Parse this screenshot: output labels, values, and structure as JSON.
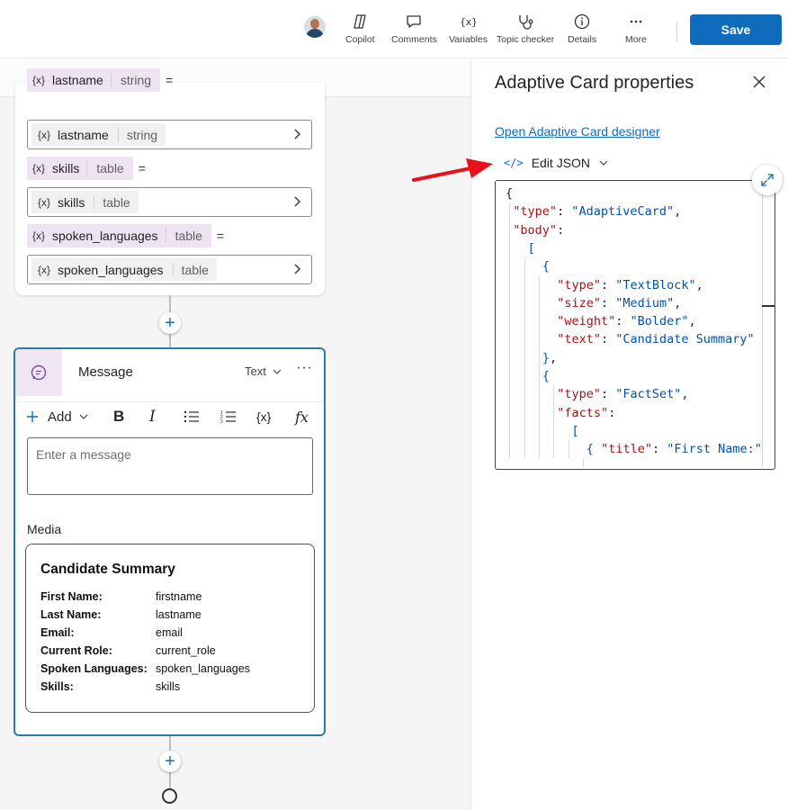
{
  "toolbar": {
    "buttons": [
      {
        "label": "Copilot"
      },
      {
        "label": "Comments"
      },
      {
        "label": "Variables"
      },
      {
        "label": "Topic checker"
      },
      {
        "label": "Details"
      },
      {
        "label": "More"
      }
    ],
    "save_label": "Save"
  },
  "variables": [
    {
      "name": "lastname",
      "type": "string",
      "equals": "=",
      "value_name": "lastname",
      "value_type": "string"
    },
    {
      "name": "skills",
      "type": "table",
      "equals": "=",
      "value_name": "skills",
      "value_type": "table"
    },
    {
      "name": "spoken_languages",
      "type": "table",
      "equals": "=",
      "value_name": "spoken_languages",
      "value_type": "table"
    }
  ],
  "var_icon_text": "{x}",
  "message_node": {
    "title": "Message",
    "type_label": "Text",
    "more": "···",
    "add_label": "Add",
    "format": {
      "bold": "B",
      "italic": "I",
      "variable": "{x}",
      "formula": "fx"
    },
    "input_placeholder": "Enter a message",
    "media_label": "Media",
    "card": {
      "title": "Candidate Summary",
      "facts": [
        {
          "title": "First Name:",
          "value": "firstname"
        },
        {
          "title": "Last Name:",
          "value": "lastname"
        },
        {
          "title": "Email:",
          "value": "email"
        },
        {
          "title": "Current Role:",
          "value": "current_role"
        },
        {
          "title": "Spoken Languages:",
          "value": "spoken_languages"
        },
        {
          "title": "Skills:",
          "value": "skills"
        }
      ]
    }
  },
  "panel": {
    "title": "Adaptive Card properties",
    "designer_link": "Open Adaptive Card designer",
    "edit_json_icon": "</>",
    "edit_json_label": "Edit JSON"
  },
  "json_lines": [
    {
      "indent": 0,
      "tokens": [
        {
          "c": "p",
          "t": "{"
        }
      ]
    },
    {
      "indent": 1,
      "tokens": [
        {
          "c": "k",
          "t": "\"type\""
        },
        {
          "c": "p",
          "t": ": "
        },
        {
          "c": "s",
          "t": "\"AdaptiveCard\""
        },
        {
          "c": "p",
          "t": ","
        }
      ]
    },
    {
      "indent": 1,
      "tokens": [
        {
          "c": "k",
          "t": "\"body\""
        },
        {
          "c": "p",
          "t": ":"
        }
      ]
    },
    {
      "indent": 2,
      "tokens": [
        {
          "c": "brk",
          "t": "["
        }
      ]
    },
    {
      "indent": 3,
      "tokens": [
        {
          "c": "brk",
          "t": "{"
        }
      ]
    },
    {
      "indent": 4,
      "tokens": [
        {
          "c": "k",
          "t": "\"type\""
        },
        {
          "c": "p",
          "t": ": "
        },
        {
          "c": "s",
          "t": "\"TextBlock\""
        },
        {
          "c": "p",
          "t": ","
        }
      ]
    },
    {
      "indent": 4,
      "tokens": [
        {
          "c": "k",
          "t": "\"size\""
        },
        {
          "c": "p",
          "t": ": "
        },
        {
          "c": "s",
          "t": "\"Medium\""
        },
        {
          "c": "p",
          "t": ","
        }
      ]
    },
    {
      "indent": 4,
      "tokens": [
        {
          "c": "k",
          "t": "\"weight\""
        },
        {
          "c": "p",
          "t": ": "
        },
        {
          "c": "s",
          "t": "\"Bolder\""
        },
        {
          "c": "p",
          "t": ","
        }
      ]
    },
    {
      "indent": 4,
      "tokens": [
        {
          "c": "k",
          "t": "\"text\""
        },
        {
          "c": "p",
          "t": ": "
        },
        {
          "c": "s",
          "t": "\"Candidate Summary\""
        }
      ]
    },
    {
      "indent": 3,
      "tokens": [
        {
          "c": "brk",
          "t": "}"
        },
        {
          "c": "p",
          "t": ","
        }
      ]
    },
    {
      "indent": 3,
      "tokens": [
        {
          "c": "brk",
          "t": "{"
        }
      ]
    },
    {
      "indent": 4,
      "tokens": [
        {
          "c": "k",
          "t": "\"type\""
        },
        {
          "c": "p",
          "t": ": "
        },
        {
          "c": "s",
          "t": "\"FactSet\""
        },
        {
          "c": "p",
          "t": ","
        }
      ]
    },
    {
      "indent": 4,
      "tokens": [
        {
          "c": "k",
          "t": "\"facts\""
        },
        {
          "c": "p",
          "t": ":"
        }
      ]
    },
    {
      "indent": 5,
      "tokens": [
        {
          "c": "brk",
          "t": "["
        }
      ]
    },
    {
      "indent": 6,
      "tokens": [
        {
          "c": "brk",
          "t": "{ "
        },
        {
          "c": "k",
          "t": "\"title\""
        },
        {
          "c": "p",
          "t": ": "
        },
        {
          "c": "s",
          "t": "\"First Name:\""
        }
      ]
    }
  ],
  "colors": {
    "accent": "#0f6cbd",
    "node_border": "#2a7aa8",
    "var_chip": "#ede3f1",
    "arrow": "#e8101a"
  }
}
